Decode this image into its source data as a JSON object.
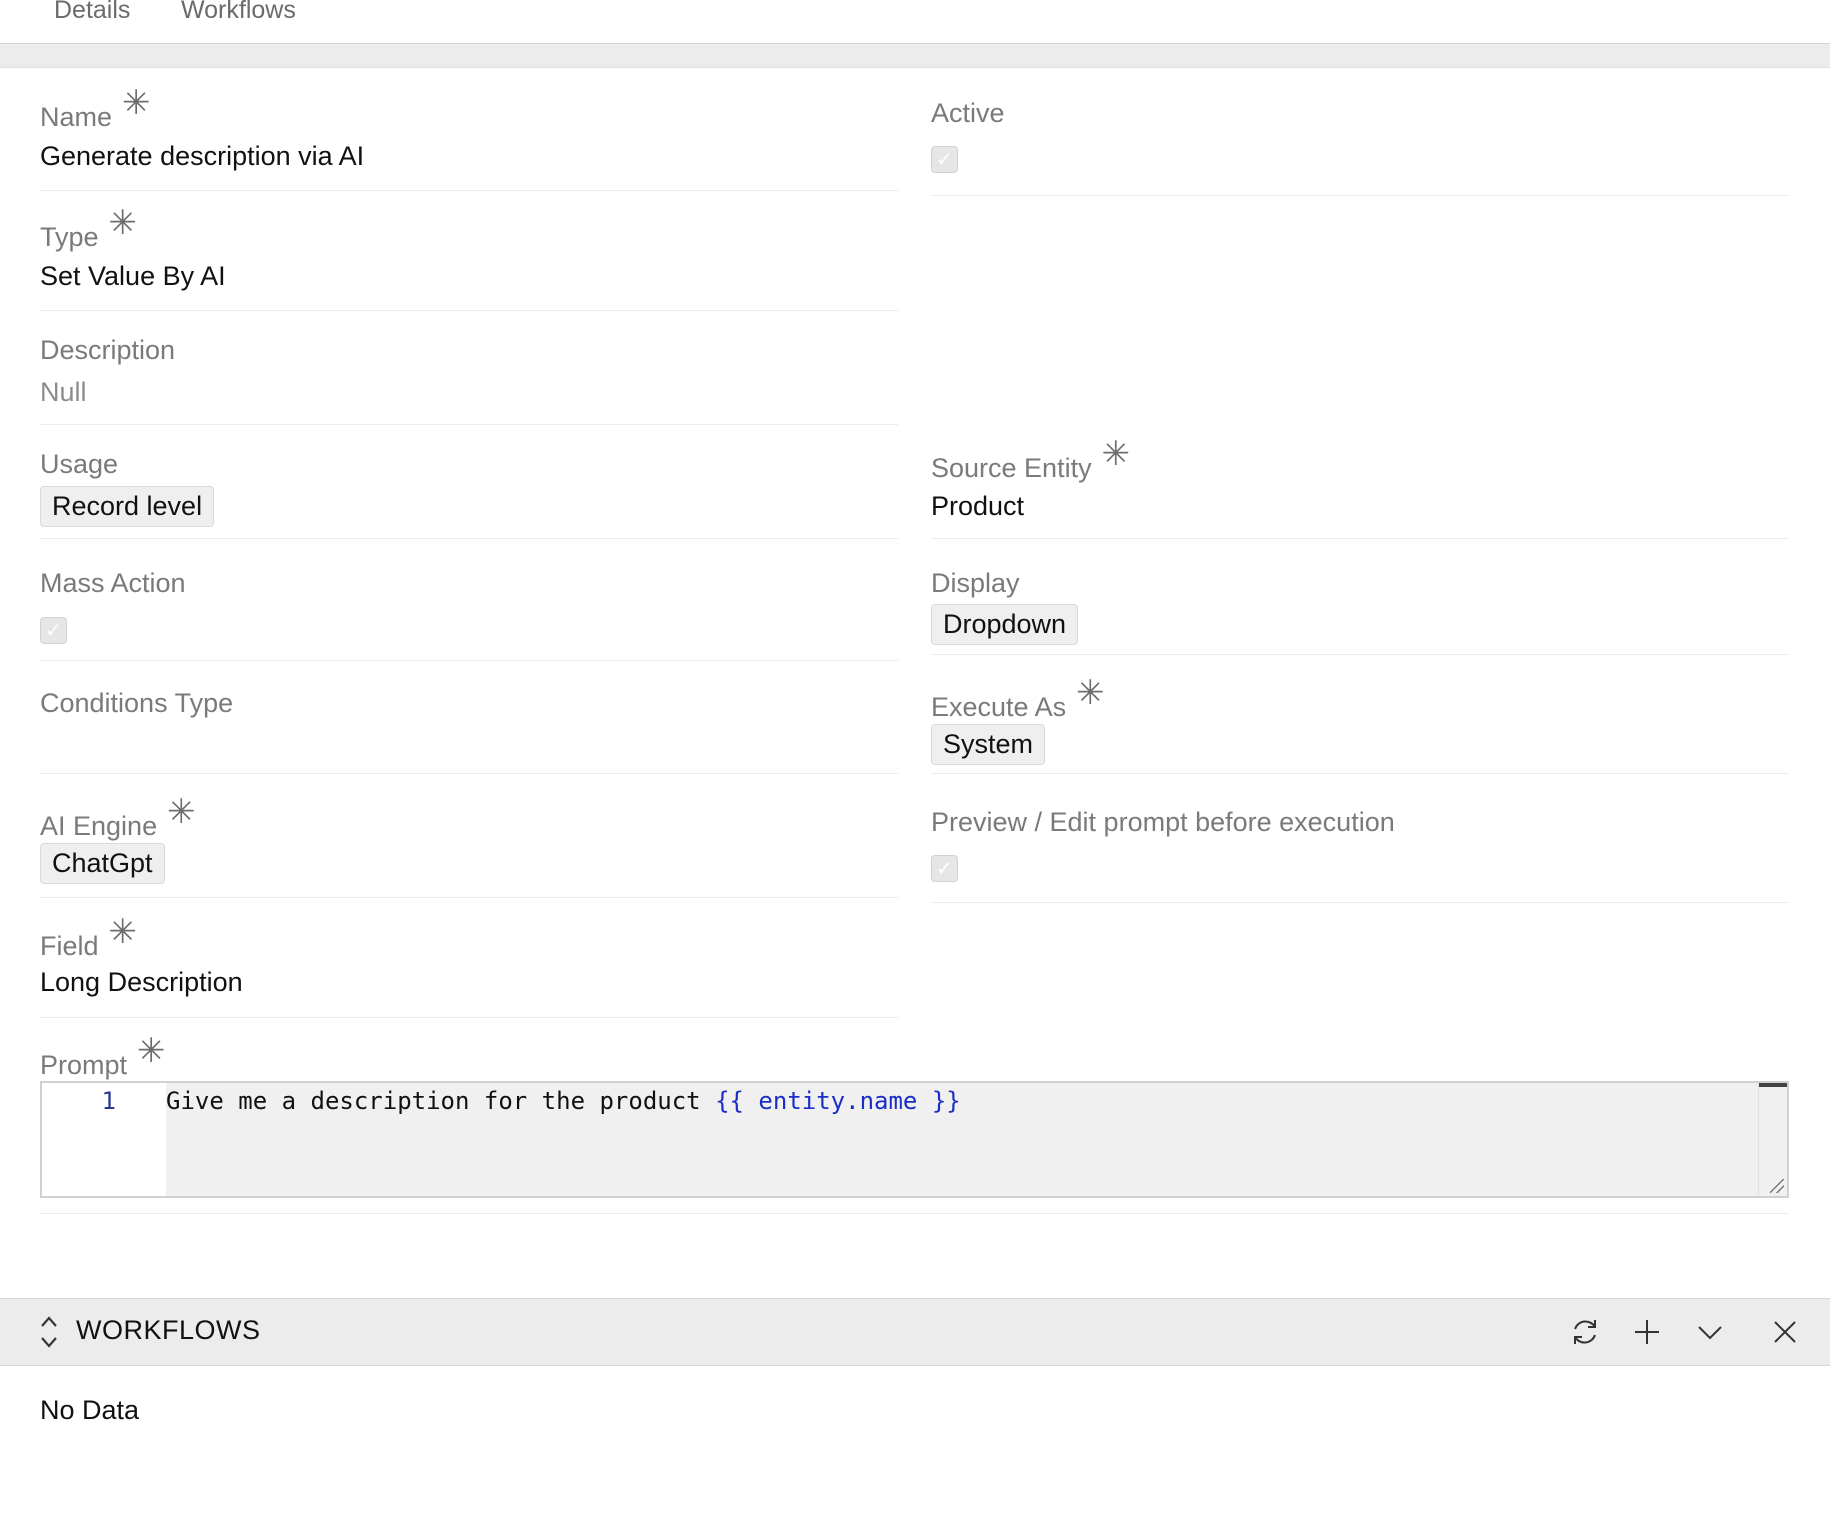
{
  "tabs": [
    "Details",
    "Workflows"
  ],
  "required_mark": "✳",
  "checkmark": "✓",
  "fields": {
    "name": {
      "label": "Name",
      "value": "Generate description via AI"
    },
    "active": {
      "label": "Active",
      "checked": true
    },
    "type": {
      "label": "Type",
      "value": "Set Value By AI"
    },
    "description": {
      "label": "Description",
      "value": "Null"
    },
    "usage": {
      "label": "Usage",
      "value": "Record level"
    },
    "source_entity": {
      "label": "Source Entity",
      "value": "Product"
    },
    "mass_action": {
      "label": "Mass Action",
      "checked": true
    },
    "display": {
      "label": "Display",
      "value": "Dropdown"
    },
    "conditions_type": {
      "label": "Conditions Type",
      "value": ""
    },
    "execute_as": {
      "label": "Execute As",
      "value": "System"
    },
    "ai_engine": {
      "label": "AI Engine",
      "value": "ChatGpt"
    },
    "preview_prompt": {
      "label": "Preview / Edit prompt before execution",
      "checked": true
    },
    "field": {
      "label": "Field",
      "value": "Long Description"
    },
    "prompt": {
      "label": "Prompt",
      "line_number": "1",
      "text": "Give me a description for the product ",
      "template": "{{ entity.name }}"
    }
  },
  "workflows_panel": {
    "title": "WORKFLOWS",
    "empty_text": "No Data",
    "icons": [
      "sort-toggle-icon",
      "refresh-icon",
      "plus-icon",
      "chevron-down-icon",
      "close-icon"
    ]
  },
  "colors": {
    "template_token": "#1a2ec7",
    "label": "#7a7a7a",
    "panel_bg": "#ececec"
  }
}
